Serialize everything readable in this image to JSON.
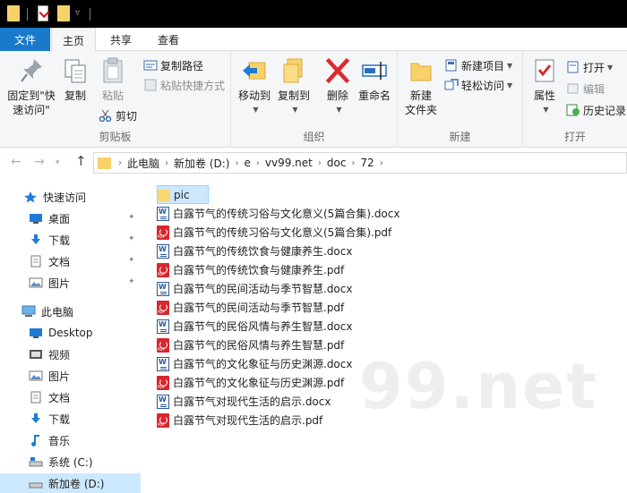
{
  "tabs": {
    "file": "文件",
    "home": "主页",
    "share": "共享",
    "view": "查看"
  },
  "ribbon": {
    "clipboard": {
      "label": "剪贴板",
      "pin": "固定到\"快\n速访问\"",
      "copy": "复制",
      "paste": "粘贴",
      "copy_path": "复制路径",
      "paste_shortcut": "粘贴快捷方式",
      "cut": "剪切"
    },
    "organize": {
      "label": "组织",
      "move_to": "移动到",
      "copy_to": "复制到",
      "delete": "删除",
      "rename": "重命名"
    },
    "new": {
      "label": "新建",
      "new_folder": "新建\n文件夹",
      "new_item": "新建项目",
      "easy_access": "轻松访问"
    },
    "open": {
      "label": "打开",
      "properties": "属性",
      "open": "打开",
      "edit": "编辑",
      "history": "历史记录"
    }
  },
  "address": {
    "crumbs": [
      "此电脑",
      "新加卷 (D:)",
      "e",
      "vv99.net",
      "doc",
      "72"
    ]
  },
  "navpane": {
    "items": [
      {
        "label": "快速访问",
        "icon": "star-icon",
        "pinned": false
      },
      {
        "label": "桌面",
        "icon": "desktop-icon",
        "pinned": true
      },
      {
        "label": "下载",
        "icon": "download-icon",
        "pinned": true
      },
      {
        "label": "文档",
        "icon": "document-icon",
        "pinned": true
      },
      {
        "label": "图片",
        "icon": "picture-icon",
        "pinned": true
      },
      {
        "label": "此电脑",
        "icon": "computer-icon",
        "pinned": false
      },
      {
        "label": "Desktop",
        "icon": "desktop-icon",
        "pinned": false
      },
      {
        "label": "视频",
        "icon": "video-icon",
        "pinned": false
      },
      {
        "label": "图片",
        "icon": "picture-icon",
        "pinned": false
      },
      {
        "label": "文档",
        "icon": "document-icon",
        "pinned": false
      },
      {
        "label": "下载",
        "icon": "download-icon",
        "pinned": false
      },
      {
        "label": "音乐",
        "icon": "music-icon",
        "pinned": false
      },
      {
        "label": "系统 (C:)",
        "icon": "drive-icon",
        "pinned": false
      },
      {
        "label": "新加卷 (D:)",
        "icon": "drive-icon",
        "pinned": false
      }
    ]
  },
  "files": [
    {
      "name": "pic",
      "type": "folder"
    },
    {
      "name": "白露节气的传统习俗与文化意义(5篇合集).docx",
      "type": "docx"
    },
    {
      "name": "白露节气的传统习俗与文化意义(5篇合集).pdf",
      "type": "pdf"
    },
    {
      "name": "白露节气的传统饮食与健康养生.docx",
      "type": "docx"
    },
    {
      "name": "白露节气的传统饮食与健康养生.pdf",
      "type": "pdf"
    },
    {
      "name": "白露节气的民间活动与季节智慧.docx",
      "type": "docx"
    },
    {
      "name": "白露节气的民间活动与季节智慧.pdf",
      "type": "pdf"
    },
    {
      "name": "白露节气的民俗风情与养生智慧.docx",
      "type": "docx"
    },
    {
      "name": "白露节气的民俗风情与养生智慧.pdf",
      "type": "pdf"
    },
    {
      "name": "白露节气的文化象征与历史渊源.docx",
      "type": "docx"
    },
    {
      "name": "白露节气的文化象征与历史渊源.pdf",
      "type": "pdf"
    },
    {
      "name": "白露节气对现代生活的启示.docx",
      "type": "docx"
    },
    {
      "name": "白露节气对现代生活的启示.pdf",
      "type": "pdf"
    }
  ],
  "watermark": "99.net"
}
